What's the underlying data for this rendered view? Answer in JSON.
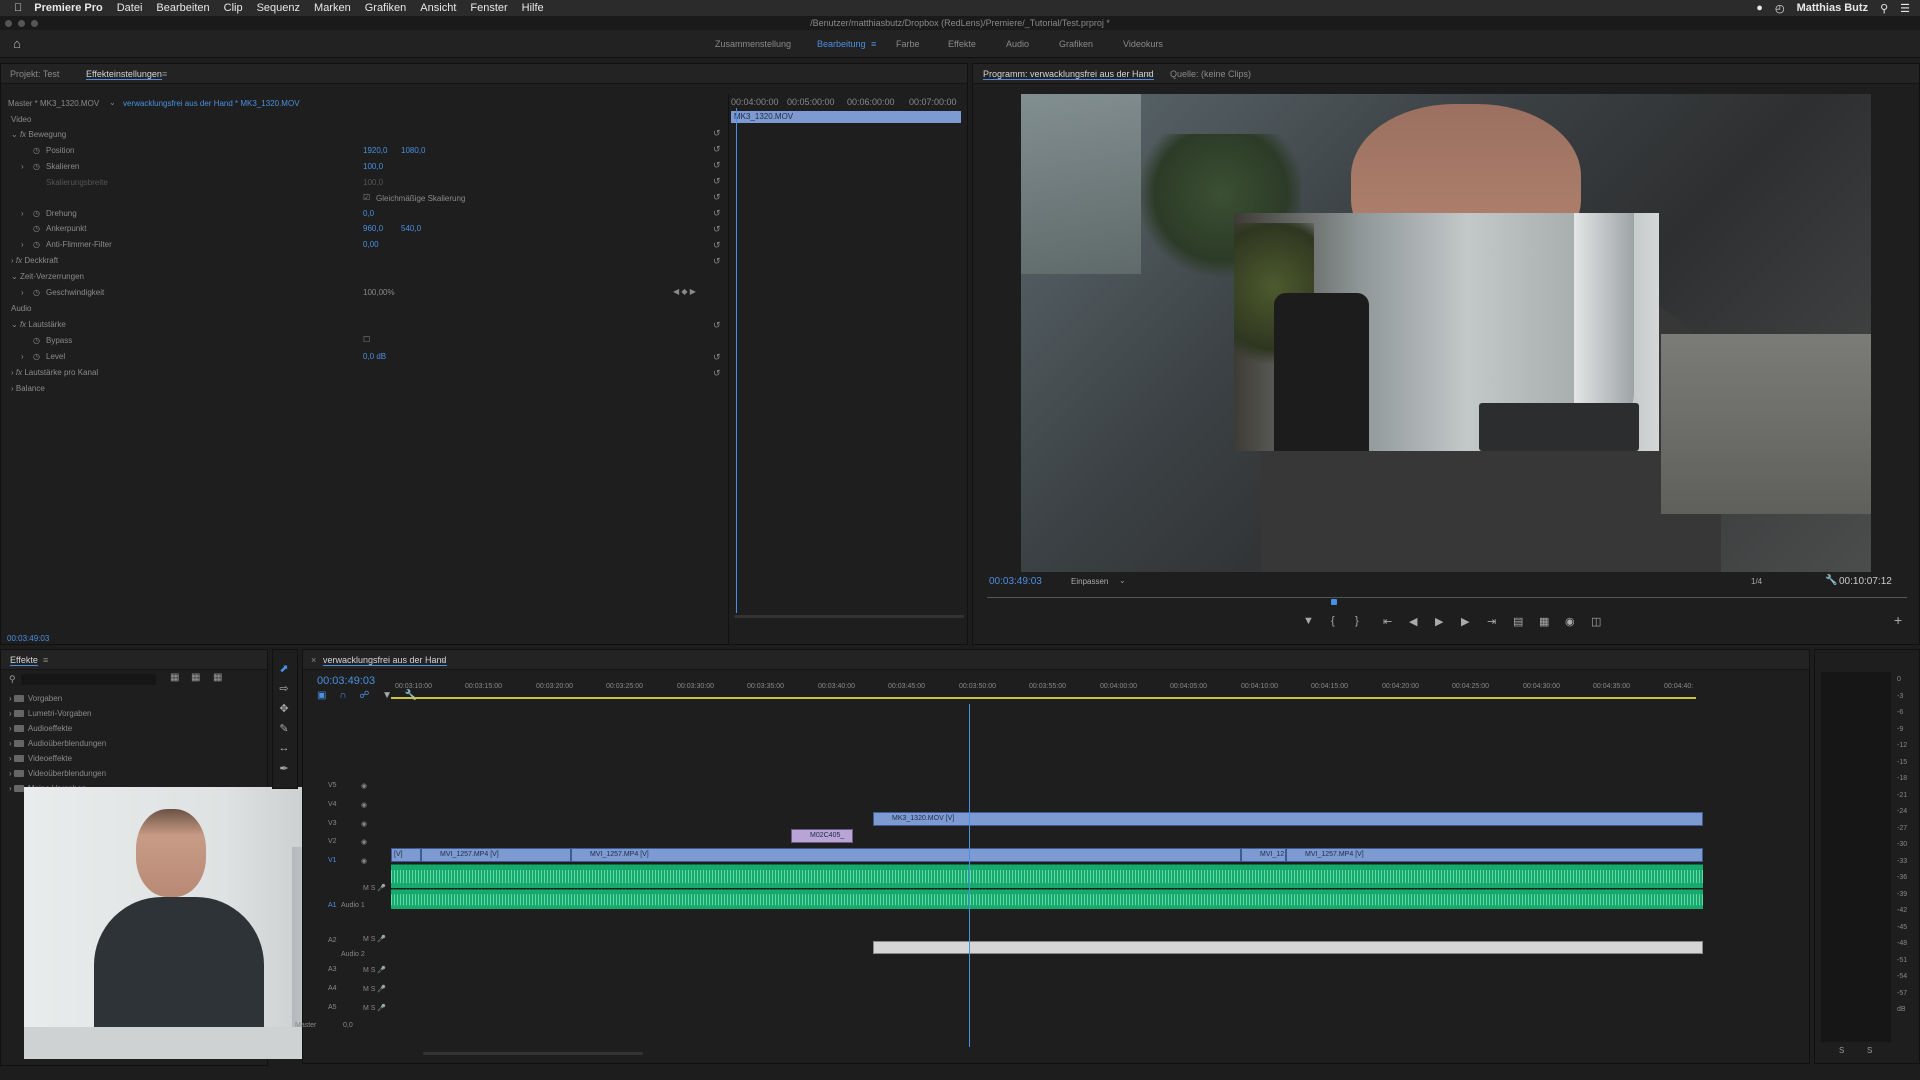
{
  "menubar": {
    "app": "Premiere Pro",
    "items": [
      "Datei",
      "Bearbeiten",
      "Clip",
      "Sequenz",
      "Marken",
      "Grafiken",
      "Ansicht",
      "Fenster",
      "Hilfe"
    ],
    "user": "Matthias Butz"
  },
  "titlebar": {
    "path": "/Benutzer/matthiasbutz/Dropbox (RedLens)/Premiere/_Tutorial/Test.prproj *"
  },
  "workspace": {
    "tabs": [
      "Zusammenstellung",
      "Bearbeitung",
      "Farbe",
      "Effekte",
      "Audio",
      "Grafiken",
      "Videokurs"
    ],
    "active": "Bearbeitung"
  },
  "effect_controls": {
    "tab_project": "Projekt: Test",
    "tab_active": "Effekteinstellungen",
    "master": "Master * MK3_1320.MOV",
    "sequence_clip": "verwacklungsfrei aus der Hand * MK3_1320.MOV",
    "video_label": "Video",
    "motion": "Bewegung",
    "position_label": "Position",
    "position_x": "1920,0",
    "position_y": "1080,0",
    "scale_label": "Skalieren",
    "scale": "100,0",
    "scale_width_label": "Skalierungsbreite",
    "scale_width": "100,0",
    "uniform_label": "Gleichmäßige Skalierung",
    "rotation_label": "Drehung",
    "rotation": "0,0",
    "anchor_label": "Ankerpunkt",
    "anchor_x": "960,0",
    "anchor_y": "540,0",
    "flicker_label": "Anti-Flimmer-Filter",
    "flicker": "0,00",
    "opacity": "Deckkraft",
    "time_remap": "Zeit-Verzerrungen",
    "speed_label": "Geschwindigkeit",
    "speed": "100,00%",
    "audio_label": "Audio",
    "volume": "Lautstärke",
    "bypass_label": "Bypass",
    "level_label": "Level",
    "level": "0,0 dB",
    "channel_volume": "Lautstärke pro Kanal",
    "balance": "Balance",
    "timecodes": [
      "00:04:00:00",
      "00:05:00:00",
      "00:06:00:00",
      "00:07:00:00"
    ],
    "mini_clip": "MK3_1320.MOV",
    "current_time": "00:03:49:03"
  },
  "program_monitor": {
    "tab": "Programm: verwacklungsfrei aus der Hand",
    "source_tab": "Quelle: (keine Clips)",
    "timecode": "00:03:49:03",
    "fit": "Einpassen",
    "resolution": "1/4",
    "duration": "00:10:07:12"
  },
  "effects_panel": {
    "tab": "Effekte",
    "items": [
      "Vorgaben",
      "Lumetri-Vorgaben",
      "Audioeffekte",
      "Audioüberblendungen",
      "Videoeffekte",
      "Videoüberblendungen",
      "Meine Vorgaben"
    ]
  },
  "timeline": {
    "tab": "verwacklungsfrei aus der Hand",
    "timecode": "00:03:49:03",
    "ruler": [
      "00:03:10:00",
      "00:03:15:00",
      "00:03:20:00",
      "00:03:25:00",
      "00:03:30:00",
      "00:03:35:00",
      "00:03:40:00",
      "00:03:45:00",
      "00:03:50:00",
      "00:03:55:00",
      "00:04:00:00",
      "00:04:05:00",
      "00:04:10:00",
      "00:04:15:00",
      "00:04:20:00",
      "00:04:25:00",
      "00:04:30:00",
      "00:04:35:00",
      "00:04:40:"
    ],
    "video_tracks": [
      "V5",
      "V4",
      "V3",
      "V2",
      "V1"
    ],
    "audio_tracks": [
      "A1",
      "A2",
      "A3",
      "A4",
      "A5"
    ],
    "audio1_name": "Audio 1",
    "audio2_name": "Audio 2",
    "master_label": "Master",
    "master_value": "0,0",
    "clips": {
      "v3": "MK3_1320.MOV [V]",
      "v2": "M02C405_",
      "v1a": "[V]",
      "v1b": "MVI_1257.MP4 [V]",
      "v1c": "MVI_1257.MP4 [V]",
      "v1d": "MVI_12",
      "v1e": "MVI_1257.MP4 [V]"
    }
  },
  "meter": {
    "labels": [
      "0",
      "-3",
      "-6",
      "-9",
      "-12",
      "-15",
      "-18",
      "-21",
      "-24",
      "-27",
      "-30",
      "-33",
      "-36",
      "-39",
      "-42",
      "-45",
      "-48",
      "-51",
      "-54",
      "-57",
      "dB"
    ],
    "solo": [
      "S",
      "S"
    ]
  }
}
